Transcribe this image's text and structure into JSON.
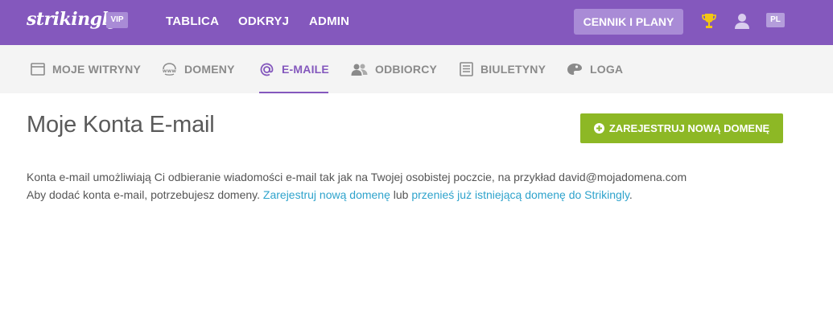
{
  "topbar": {
    "logo": "strikingly",
    "vip_badge": "VIP",
    "nav": [
      "TABLICA",
      "ODKRYJ",
      "ADMIN"
    ],
    "pricing_button": "CENNIK I PLANY",
    "lang_badge": "PL",
    "icons": [
      "trophy-icon",
      "user-icon"
    ]
  },
  "subnav": {
    "items": [
      {
        "label": "MOJE WITRYNY",
        "icon": "window-icon"
      },
      {
        "label": "DOMENY",
        "icon": "www-icon"
      },
      {
        "label": "E-MAILE",
        "icon": "at-icon",
        "active": true
      },
      {
        "label": "ODBIORCY",
        "icon": "people-icon"
      },
      {
        "label": "BIULETYNY",
        "icon": "newsletter-icon"
      },
      {
        "label": "LOGA",
        "icon": "palette-icon"
      }
    ]
  },
  "main": {
    "title": "Moje Konta E-mail",
    "register_button": "ZAREJESTRUJ NOWĄ DOMENĘ",
    "line1": "Konta e-mail umożliwiają Ci odbieranie wiadomości e-mail tak jak na Twojej osobistej poczcie, na przykład david@mojadomena.com",
    "line2_prefix": "Aby dodać konta e-mail, potrzebujesz domeny. ",
    "line2_link1": "Zarejestruj nową domenę",
    "line2_middle": " lub ",
    "line2_link2": "przenieś już istniejącą domenę do Strikingly",
    "line2_suffix": "."
  },
  "colors": {
    "brand_purple": "#8458bd",
    "badge_purple": "#a98bd6",
    "green_button": "#8db825",
    "link_blue": "#2ea3cc",
    "trophy_gold": "#f3c614"
  }
}
